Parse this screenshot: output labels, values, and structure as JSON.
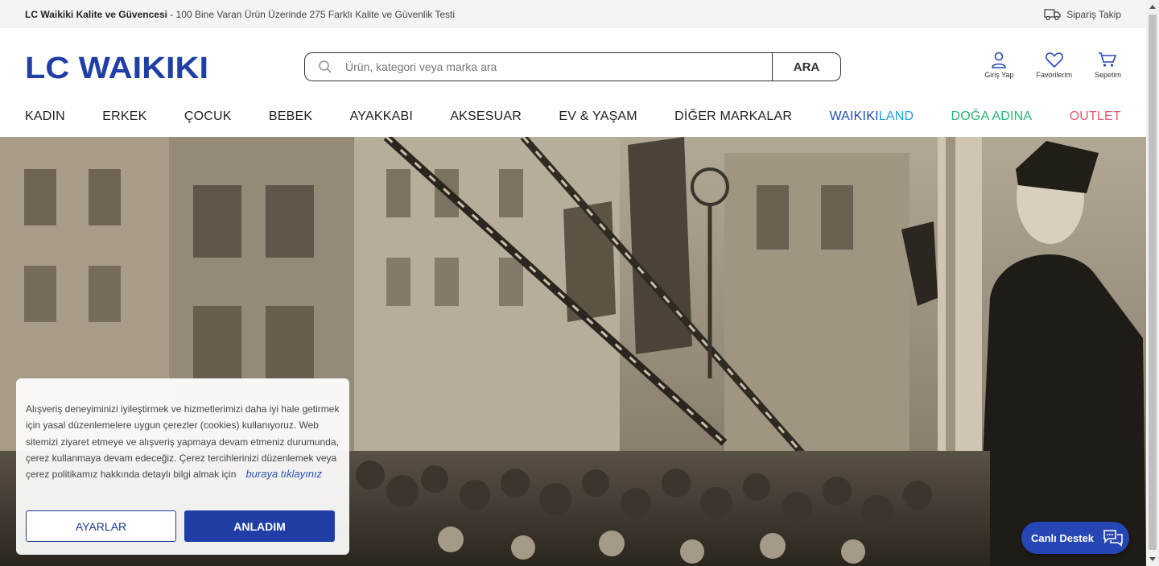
{
  "topbar": {
    "promo_bold": "LC Waikiki Kalite ve Güvencesi",
    "promo_rest": " - 100 Bine Varan Ürün Üzerinde 275 Farklı Kalite ve Güvenlik Testi",
    "order_track": "Sipariş Takip"
  },
  "header": {
    "logo_text": "LC WAIKIKI",
    "search_placeholder": "Ürün, kategori veya marka ara",
    "search_button": "ARA",
    "login": "Giriş Yap",
    "favorites": "Favorilerim",
    "cart": "Sepetim"
  },
  "nav": {
    "items": [
      "KADIN",
      "ERKEK",
      "ÇOCUK",
      "BEBEK",
      "AYAKKABI",
      "AKSESUAR",
      "EV & YAŞAM",
      "DİĞER MARKALAR"
    ],
    "waikiki_part1": "WAIKIKI",
    "waikiki_part2": "LAND",
    "doga": "DOĞA ADINA",
    "outlet": "OUTLET"
  },
  "cookie": {
    "text": "Alışveriş deneyiminizi iyileştirmek ve hizmetlerimizi daha iyi hale getirmek için yasal düzenlemelere uygun çerezler (cookies) kullanıyoruz. Web sitemizi ziyaret etmeye ve alışveriş yapmaya devam etmeniz durumunda, çerez kullanmaya devam edeceğiz. Çerez tercihlerinizi düzenlemek veya çerez politikamız hakkında detaylı bilgi almak için",
    "link": "buraya tıklayınız",
    "settings_button": "AYARLAR",
    "accept_button": "ANLADIM"
  },
  "chat": {
    "label": "Canlı Destek"
  },
  "colors": {
    "brand": "#1f3fa6",
    "waikikiland": "#1ea3e4",
    "doga": "#2bb673",
    "outlet": "#e8596c"
  }
}
